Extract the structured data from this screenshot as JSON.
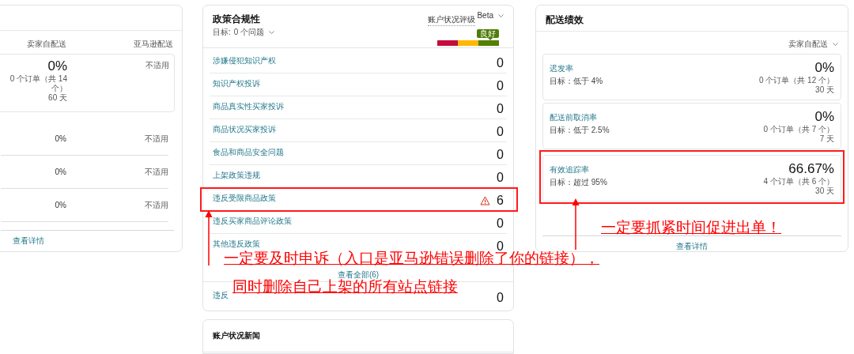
{
  "shipping_card": {
    "columns": [
      "卖家自配送",
      "亚马逊配送"
    ],
    "rows": [
      {
        "boxed": true,
        "value": "0%",
        "orders": "0 个订单（共 14 个）",
        "days": "60 天",
        "other": "不适用"
      },
      {
        "boxed": false,
        "value": "0%",
        "other": "不适用"
      },
      {
        "boxed": false,
        "value": "0%",
        "other": "不适用"
      },
      {
        "boxed": false,
        "value": "0%",
        "other": "不适用"
      }
    ],
    "link": "查看详情"
  },
  "policy_card": {
    "title": "政策合规性",
    "target_label": "目标:",
    "target": "0 个问题",
    "rating_label": "账户状况评级",
    "rating_tag": "Beta",
    "rating_badge": "良好",
    "rating_segments": [
      {
        "color": "#c40d3c",
        "selected": false
      },
      {
        "color": "#ffb700",
        "selected": false
      },
      {
        "color": "#538000",
        "selected": true
      }
    ],
    "rows": [
      {
        "label": "涉嫌侵犯知识产权",
        "count": "0",
        "warning": false,
        "highlighted": false
      },
      {
        "label": "知识产权投诉",
        "count": "0",
        "warning": false,
        "highlighted": false
      },
      {
        "label": "商品真实性买家投诉",
        "count": "0",
        "warning": false,
        "highlighted": false
      },
      {
        "label": "商品状况买家投诉",
        "count": "0",
        "warning": false,
        "highlighted": false
      },
      {
        "label": "食品和商品安全问题",
        "count": "0",
        "warning": false,
        "highlighted": false
      },
      {
        "label": "上架政策违规",
        "count": "0",
        "warning": false,
        "highlighted": false
      },
      {
        "label": "违反受限商品政策",
        "count": "6",
        "warning": true,
        "highlighted": true
      },
      {
        "label": "违反买家商品评论政策",
        "count": "0",
        "warning": false,
        "highlighted": false
      },
      {
        "label": "其他违反政策",
        "count": "0",
        "warning": false,
        "highlighted": false
      }
    ],
    "view_all": "查看全部(6)",
    "extra_row": {
      "label": "违反",
      "count": "0"
    }
  },
  "news_card": {
    "title": "账户状况新闻"
  },
  "delivery_card": {
    "title": "配送绩效",
    "filter": "卖家自配送",
    "metrics": [
      {
        "name": "迟发率",
        "target": "目标：低于 4%",
        "value": "0%",
        "orders": "0 个订单（共 12 个）",
        "days": "30 天",
        "highlighted": false
      },
      {
        "name": "配送前取消率",
        "target": "目标：低于 2.5%",
        "value": "0%",
        "orders": "0 个订单（共 7 个）",
        "days": "7 天",
        "highlighted": false
      },
      {
        "name": "有效追踪率",
        "target": "目标：超过 95%",
        "value": "66.67%",
        "orders": "4 个订单（共 6 个）",
        "days": "30 天",
        "highlighted": true
      }
    ],
    "link": "查看详情"
  },
  "annotations": [
    {
      "text": "一定要及时申诉（入口是亚马逊错误删除了你的链接），"
    },
    {
      "text": "同时删除自己上架的所有站点链接"
    },
    {
      "text": "一定要抓紧时间促进出单！"
    }
  ]
}
